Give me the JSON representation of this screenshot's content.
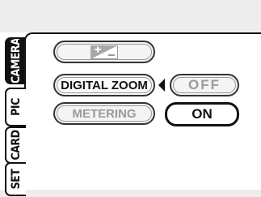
{
  "tabs": [
    {
      "label": "CAMERA",
      "active": true
    },
    {
      "label": "PIC",
      "active": false
    },
    {
      "label": "CARD",
      "active": false
    },
    {
      "label": "SET",
      "active": false
    }
  ],
  "menu": {
    "row1": {
      "icon": "exposure-compensation-icon"
    },
    "row2": {
      "label": "DIGITAL ZOOM",
      "value": "OFF"
    },
    "row3": {
      "label": "METERING",
      "value": "ON"
    }
  },
  "colors": {
    "active_tab_bg": "#111111",
    "inactive_text": "#9a9a9a",
    "background_band": "#ededed"
  }
}
